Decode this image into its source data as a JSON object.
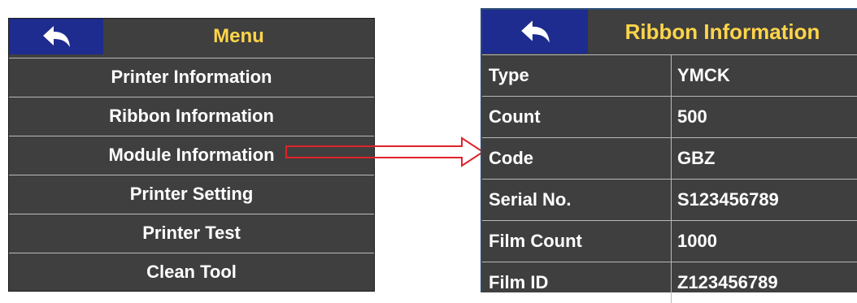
{
  "menu": {
    "title": "Menu",
    "back_icon": "back-arrow-icon",
    "items": [
      {
        "label": "Printer Information"
      },
      {
        "label": "Ribbon Information"
      },
      {
        "label": "Module Information"
      },
      {
        "label": "Printer Setting"
      },
      {
        "label": "Printer Test"
      },
      {
        "label": "Clean Tool"
      }
    ]
  },
  "ribbon": {
    "title": "Ribbon Information",
    "back_icon": "back-arrow-icon",
    "rows": [
      {
        "label": "Type",
        "value": "YMCK"
      },
      {
        "label": "Count",
        "value": "500"
      },
      {
        "label": "Code",
        "value": "GBZ"
      },
      {
        "label": "Serial No.",
        "value": "S123456789"
      },
      {
        "label": "Film Count",
        "value": "1000"
      },
      {
        "label": "Film ID",
        "value": "Z123456789"
      }
    ]
  },
  "colors": {
    "panel_bg": "#3f3f3f",
    "header_button_bg": "#1d2c8e",
    "title_text": "#ffd54a",
    "item_text": "#ffffff",
    "annotation_arrow": "#e0232a"
  }
}
